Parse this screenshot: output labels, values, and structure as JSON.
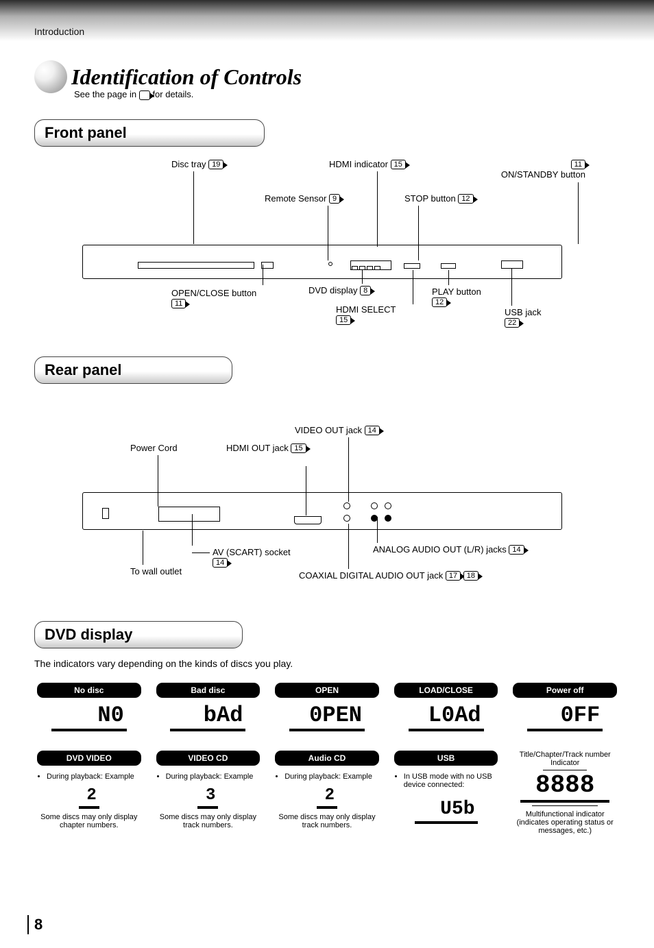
{
  "intro_label": "Introduction",
  "title": "Identification of Controls",
  "sub_note_a": "See the page in ",
  "sub_note_b": " for details.",
  "panel1": "Front panel",
  "panel2": "Rear panel",
  "panel3": "DVD display",
  "dvd_display_intro": "The indicators vary depending on the kinds of discs you play.",
  "front": {
    "disc_tray": "Disc tray",
    "disc_tray_ref": "19",
    "hdmi_ind": "HDMI indicator",
    "hdmi_ind_ref": "15",
    "on_standby": "ON/STANDBY button",
    "on_standby_ref": "11",
    "remote_sensor": "Remote Sensor",
    "remote_sensor_ref": "9",
    "stop_btn": "STOP button",
    "stop_btn_ref": "12",
    "open_close": "OPEN/CLOSE button",
    "open_close_ref": "11",
    "dvd_display": "DVD display",
    "dvd_display_ref": "8",
    "hdmi_select": "HDMI SELECT",
    "hdmi_select_ref": "15",
    "play_btn": "PLAY button",
    "play_btn_ref": "12",
    "usb_jack": "USB jack",
    "usb_jack_ref": "22"
  },
  "rear": {
    "power_cord": "Power Cord",
    "video_out": "VIDEO OUT jack",
    "video_out_ref": "14",
    "hdmi_out": "HDMI OUT jack",
    "hdmi_out_ref": "15",
    "to_wall": "To wall outlet",
    "av_scart": "AV (SCART) socket",
    "av_scart_ref": "14",
    "analog_lr": "ANALOG AUDIO OUT (L/R) jacks",
    "analog_lr_ref": "14",
    "coax": "COAXIAL DIGITAL AUDIO OUT jack",
    "coax_ref1": "17",
    "coax_ref2": "18"
  },
  "displays_row1": [
    {
      "head": "No disc",
      "seg": "N0"
    },
    {
      "head": "Bad disc",
      "seg": "bAd"
    },
    {
      "head": "OPEN",
      "seg": "0PEN"
    },
    {
      "head": "LOAD/CLOSE",
      "seg": "L0Ad"
    },
    {
      "head": "Power off",
      "seg": "0FF"
    }
  ],
  "displays_row2": {
    "dvd": {
      "head": "DVD VIDEO",
      "bullet": "During playback: Example",
      "seg": "2",
      "note": "Some discs may only display chapter numbers."
    },
    "vcd": {
      "head": "VIDEO CD",
      "bullet": "During playback: Example",
      "seg": "3",
      "note": "Some discs may only display track numbers."
    },
    "acd": {
      "head": "Audio CD",
      "bullet": "During playback: Example",
      "seg": "2",
      "note": "Some discs may only display track numbers."
    },
    "usb": {
      "head": "USB",
      "bullet": "In USB mode with no USB device connected:",
      "seg": "U5b"
    },
    "title_ind": "Title/Chapter/Track number Indicator",
    "all8": "8888",
    "multi_ind": "Multifunctional indicator (indicates operating status or messages, etc.)"
  },
  "page_number": "8"
}
